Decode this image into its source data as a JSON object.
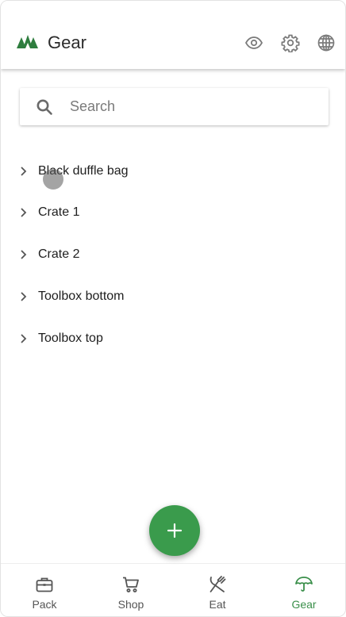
{
  "app": {
    "title": "Gear",
    "accent_color": "#3a9b4c",
    "logo_icon": "forest-icon"
  },
  "toolbar": {
    "icons": [
      "eye-icon",
      "gear-icon",
      "globe-icon"
    ]
  },
  "search": {
    "placeholder": "Search",
    "value": ""
  },
  "list": {
    "items": [
      {
        "label": "Black duffle bag"
      },
      {
        "label": "Crate 1"
      },
      {
        "label": "Crate 2"
      },
      {
        "label": "Toolbox bottom"
      },
      {
        "label": "Toolbox top"
      }
    ]
  },
  "fab": {
    "icon": "plus-icon"
  },
  "bottom_nav": {
    "active": "Gear",
    "items": [
      {
        "label": "Pack",
        "icon": "briefcase-icon"
      },
      {
        "label": "Shop",
        "icon": "cart-icon"
      },
      {
        "label": "Eat",
        "icon": "utensils-icon"
      },
      {
        "label": "Gear",
        "icon": "umbrella-icon"
      }
    ]
  }
}
